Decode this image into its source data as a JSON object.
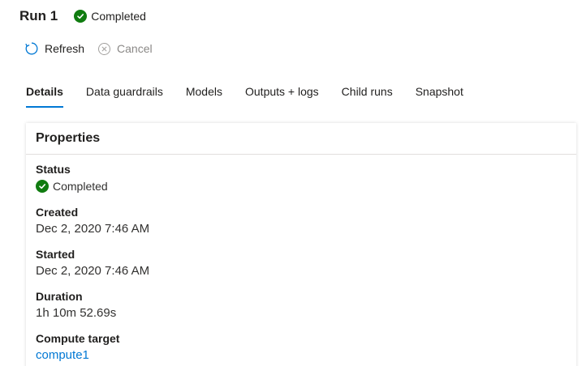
{
  "header": {
    "title": "Run 1",
    "status": "Completed"
  },
  "toolbar": {
    "refresh_label": "Refresh",
    "cancel_label": "Cancel"
  },
  "tabs": [
    {
      "label": "Details",
      "active": true
    },
    {
      "label": "Data guardrails"
    },
    {
      "label": "Models"
    },
    {
      "label": "Outputs + logs"
    },
    {
      "label": "Child runs"
    },
    {
      "label": "Snapshot"
    }
  ],
  "properties": {
    "title": "Properties",
    "status_label": "Status",
    "status_value": "Completed",
    "created_label": "Created",
    "created_value": "Dec 2, 2020 7:46 AM",
    "started_label": "Started",
    "started_value": "Dec 2, 2020 7:46 AM",
    "duration_label": "Duration",
    "duration_value": "1h 10m 52.69s",
    "compute_label": "Compute target",
    "compute_value": "compute1"
  },
  "colors": {
    "accent": "#0078d4",
    "success": "#107c10",
    "disabled": "#8a8886"
  }
}
